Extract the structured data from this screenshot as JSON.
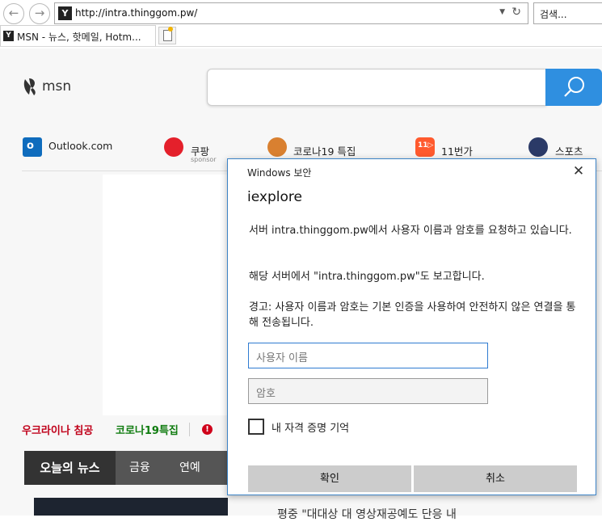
{
  "browser": {
    "url": "http://intra.thinggom.pw/",
    "search_placeholder": "검색...",
    "tab_title": "MSN - 뉴스, 핫메일, Hotm..."
  },
  "msn": {
    "logo_text": "msn",
    "quicklinks": [
      {
        "label": "Outlook.com"
      },
      {
        "label": "쿠팡",
        "sub": "sponsor"
      },
      {
        "label": "코로나19 특집"
      },
      {
        "label": "11번가"
      },
      {
        "label": "스포츠"
      }
    ],
    "trending": [
      "우크라이나 침공",
      "코로나19특집"
    ],
    "news_tabs": [
      "오늘의 뉴스",
      "금융",
      "연예"
    ],
    "news_headline_partial": "평중 \"대대상 대 영상재공예도 단응 내"
  },
  "dialog": {
    "title": "Windows 보안",
    "app_name": "iexplore",
    "message1": "서버 intra.thinggom.pw에서 사용자 이름과 암호를 요청하고 있습니다.",
    "message2": "해당 서버에서 \"intra.thinggom.pw\"도 보고합니다.",
    "message3": "경고: 사용자 이름과 암호는 기본 인증을 사용하여 안전하지 않은 연결을 통해 전송됩니다.",
    "username_placeholder": "사용자 이름",
    "password_placeholder": "암호",
    "remember_label": "내 자격 증명 기억",
    "ok_label": "확인",
    "cancel_label": "취소"
  },
  "colors": {
    "dialog_border": "#3c83c6",
    "msn_search_button": "#2f8fe0",
    "trending_red": "#c0001a",
    "trending_green": "#107c10"
  }
}
